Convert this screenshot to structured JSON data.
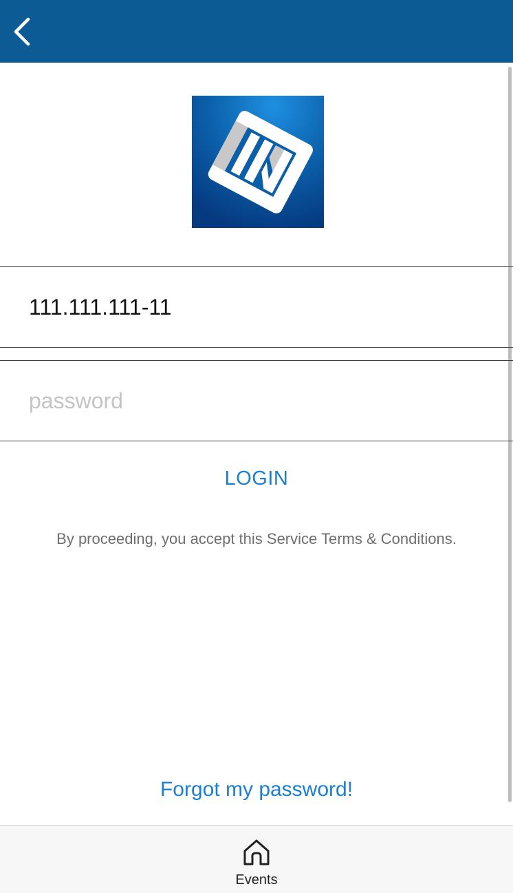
{
  "colors": {
    "header_bg": "#0d5b95",
    "accent": "#1b7fd1",
    "logo_blue": "#0b5ea8"
  },
  "header": {
    "back_icon": "chevron-left-icon"
  },
  "logo": {
    "icon": "app-logo-icon"
  },
  "login_form": {
    "cpf_value": "111.111.111-11",
    "password_placeholder": "password",
    "login_label": "LOGIN",
    "terms_text": "By proceeding, you accept this Service Terms & Conditions.",
    "forgot_label": "Forgot my password!"
  },
  "tabbar": {
    "tabs": [
      {
        "label": "Events",
        "icon": "home-icon"
      }
    ]
  }
}
